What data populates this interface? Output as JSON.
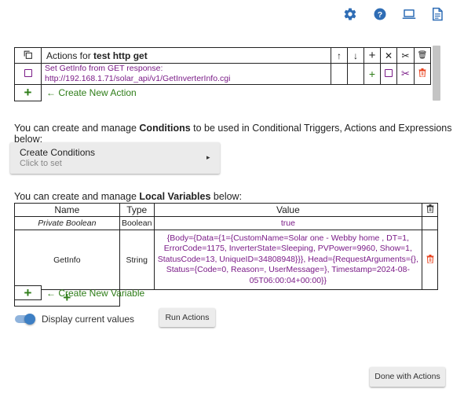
{
  "header": {
    "icons": [
      "gear-icon",
      "help-icon",
      "laptop-icon",
      "document-icon"
    ],
    "accent": "#2f6db5"
  },
  "actions": {
    "title_prefix": "Actions for",
    "title_name": "test http get",
    "header_icons": [
      "↑",
      "↓",
      "+",
      "✕",
      "✂",
      "🗑"
    ],
    "rows": [
      {
        "line1": "Set GetInfo from GET response:",
        "line2": "http://192.168.1.71/solar_api/v1/GetInverterInfo.cgi"
      }
    ],
    "add_symbol": "+",
    "create_label": "← Create New Action"
  },
  "conditions": {
    "intro_before": "You can create and manage",
    "intro_bold": "Conditions",
    "intro_after": "to be used in Conditional Triggers, Actions and Expressions below:",
    "button_title": "Create Conditions",
    "button_subtitle": "Click to set",
    "button_arrow": "▸"
  },
  "variables": {
    "intro_before": "You can create and manage",
    "intro_bold": "Local Variables",
    "intro_after": "below:",
    "columns": [
      "Name",
      "Type",
      "Value"
    ],
    "rows": [
      {
        "name": "Private Boolean",
        "type": "Boolean",
        "value": "true"
      },
      {
        "name": "GetInfo",
        "type": "String",
        "value_lines": [
          "{Body={Data={1={CustomName=Solar one - Webby home , DT=1,",
          "ErrorCode=1175, InverterState=Sleeping, PVPower=9960, Show=1,",
          "StatusCode=13, UniqueID=34808948}}}, Head={RequestArguments={},",
          "Status={Code=0, Reason=, UserMessage=}, Timestamp=2024-08-",
          "05T06:00:04+00:00}}"
        ]
      }
    ],
    "add_symbol": "+",
    "create_label": "← Create New Variable"
  },
  "footer": {
    "toggle_label": "Display current values",
    "toggle_on": true,
    "run_label": "Run Actions",
    "done_label": "Done with Actions"
  }
}
